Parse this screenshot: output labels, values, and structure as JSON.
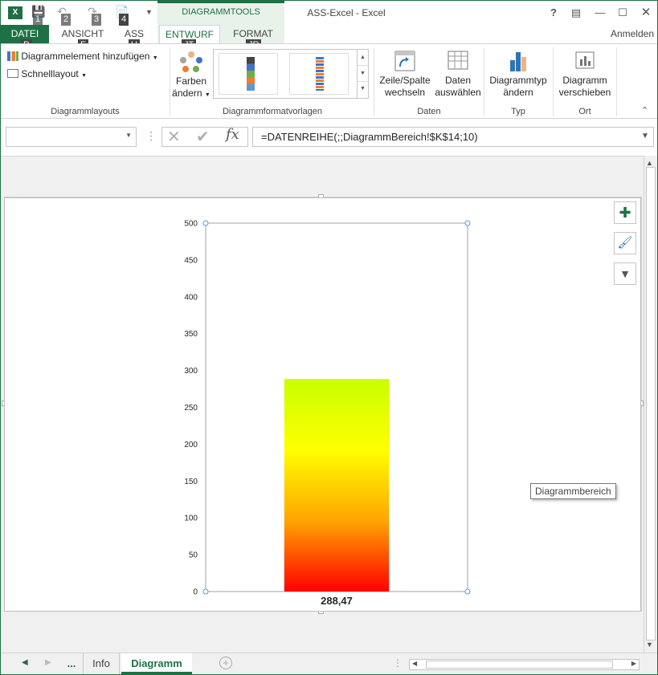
{
  "titlebar": {
    "title": "ASS-Excel - Excel",
    "context_group": "DIAGRAMMTOOLS",
    "signin": "Anmelden",
    "help": "?",
    "app_icon_letter": "X",
    "qat_keytips": [
      "1",
      "2",
      "3",
      "4"
    ]
  },
  "tabs": {
    "file": "DATEI",
    "view": "ANSICHT",
    "ass": "ASS",
    "design": "ENTWURF",
    "format": "FORMAT",
    "keytips": {
      "file": "D",
      "view": "F",
      "ass": "U",
      "design": "JT",
      "format": "JR"
    }
  },
  "ribbon": {
    "layouts": {
      "add_element": "Diagrammelement hinzufügen",
      "quick_layout": "Schnelllayout",
      "label": "Diagrammlayouts"
    },
    "styles": {
      "colors_line1": "Farben",
      "colors_line2": "ändern",
      "label": "Diagrammformatvorlagen"
    },
    "data": {
      "switch_line1": "Zeile/Spalte",
      "switch_line2": "wechseln",
      "select_line1": "Daten",
      "select_line2": "auswählen",
      "label": "Daten"
    },
    "type": {
      "change_line1": "Diagrammtyp",
      "change_line2": "ändern",
      "label": "Typ"
    },
    "location": {
      "move_line1": "Diagramm",
      "move_line2": "verschieben",
      "label": "Ort"
    }
  },
  "formula_bar": {
    "name_box": "",
    "formula": "=DATENREIHE(;;DiagrammBereich!$K$14;10)"
  },
  "chart_data": {
    "type": "bar",
    "categories": [
      ""
    ],
    "values": [
      288.47
    ],
    "data_label": "288,47",
    "ylim": [
      0,
      500
    ],
    "yticks": [
      "0",
      "50",
      "100",
      "150",
      "200",
      "250",
      "300",
      "350",
      "400",
      "450",
      "500"
    ],
    "gradient_colors": [
      "#ff0000",
      "#ffa500",
      "#ffff00",
      "#c8ff00"
    ],
    "grid": false,
    "legend": "none"
  },
  "tooltip": "Diagrammbereich",
  "sheet_tabs": {
    "more": "...",
    "tabs": [
      "Info",
      "Diagramm"
    ],
    "active": "Diagramm"
  },
  "colors": {
    "accent": "#1e7145"
  }
}
